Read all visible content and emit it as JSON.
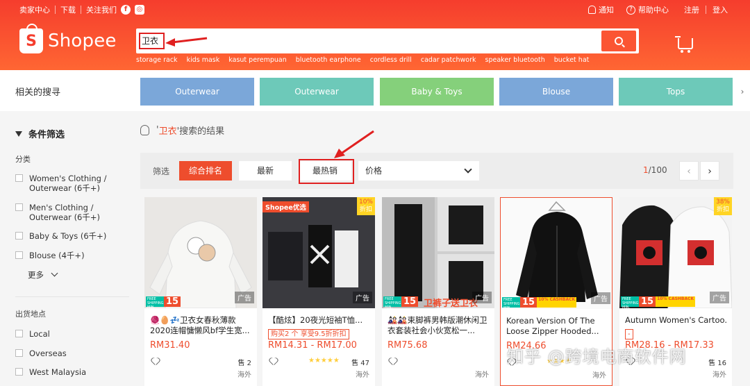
{
  "topbar": {
    "seller_center": "卖家中心",
    "download": "下载",
    "follow_us": "关注我们",
    "notifications": "通知",
    "help_center": "帮助中心",
    "register": "注册",
    "login": "登入"
  },
  "brand": {
    "name": "Shopee",
    "color": "#ee4d2d"
  },
  "search": {
    "value": "卫衣",
    "hints": [
      "storage rack",
      "kids mask",
      "kasut perempuan",
      "bluetooth earphone",
      "cordless drill",
      "cadar patchwork",
      "speaker bluetooth",
      "bucket hat"
    ]
  },
  "related": {
    "label": "相关的搜寻",
    "chips": [
      {
        "label": "Outerwear",
        "color": "#7ba7d9"
      },
      {
        "label": "Outerwear",
        "color": "#6dc9b9"
      },
      {
        "label": "Baby & Toys",
        "color": "#85d07b"
      },
      {
        "label": "Blouse",
        "color": "#7ba7d9"
      },
      {
        "label": "Tops",
        "color": "#6dc9b9"
      }
    ]
  },
  "sidebar": {
    "filter_title": "条件筛选",
    "category_title": "分类",
    "categories": [
      {
        "label": "Women's Clothing / Outerwear (6千+)"
      },
      {
        "label": "Men's Clothing / Outerwear (6千+)"
      },
      {
        "label": "Baby & Toys (6千+)"
      },
      {
        "label": "Blouse (4千+)"
      }
    ],
    "more": "更多",
    "location_title": "出货地点",
    "locations": [
      "Local",
      "Overseas",
      "West Malaysia"
    ]
  },
  "results": {
    "prefix": "'",
    "keyword": "卫衣",
    "suffix": "'搜索的结果"
  },
  "sortbar": {
    "label": "筛选",
    "relevance": "综合排名",
    "latest": "最新",
    "top_sales": "最热销",
    "price": "价格",
    "page_current": "1",
    "page_total": "/100"
  },
  "products": [
    {
      "title": "🧶🥚💤卫衣女春秋薄款2020连帽慵懒风bf学生宽...",
      "price": "RM31.40",
      "stars": "",
      "sold": "售 2",
      "location": "海外",
      "ad": "广告",
      "free_ship": "FREE SHIPPING MIN. SPEND",
      "fs_num": "15"
    },
    {
      "title": "【酷炫】20夜光短袖T恤...",
      "promo": "购买2 个 享受9.5折折扣",
      "price": "RM14.31 - RM17.00",
      "stars": "★★★★★",
      "sold": "售 47",
      "location": "海外",
      "ad": "广告",
      "mall": "Shopee优选",
      "discount": "10%",
      "discount_off": "折扣"
    },
    {
      "title": "🎎🎎束脚裤男韩版潮休闲卫衣套装社会小伙宽松一...",
      "price": "RM75.68",
      "stars": "",
      "sold": "",
      "location": "海外",
      "ad": "广告",
      "free_ship": "FREE SHIPPING MIN. SPEND",
      "fs_num": "15",
      "img_text": "卫裤子送卫衣"
    },
    {
      "title": "Korean Version Of The Loose Zipper Hooded...",
      "price": "RM24.66",
      "stars": "★★★★",
      "sold": "",
      "location": "海外",
      "ad": "广告",
      "free_ship": "FREE SHIPPING MIN. SPEND",
      "fs_num": "15",
      "cashback": "10% CASHBACK"
    },
    {
      "title": "Autumn Women's Cartoo...",
      "promo": "-",
      "price": "RM28.16 - RM17.33",
      "stars": "",
      "sold": "售 16",
      "location": "海外",
      "ad": "广告",
      "free_ship": "FREE SHIPPING MIN. SPEND",
      "fs_num": "15",
      "cashback": "10% CASHBACK",
      "discount": "38%",
      "discount_off": "折扣"
    }
  ],
  "watermark": "知乎 @跨境电商软件网"
}
